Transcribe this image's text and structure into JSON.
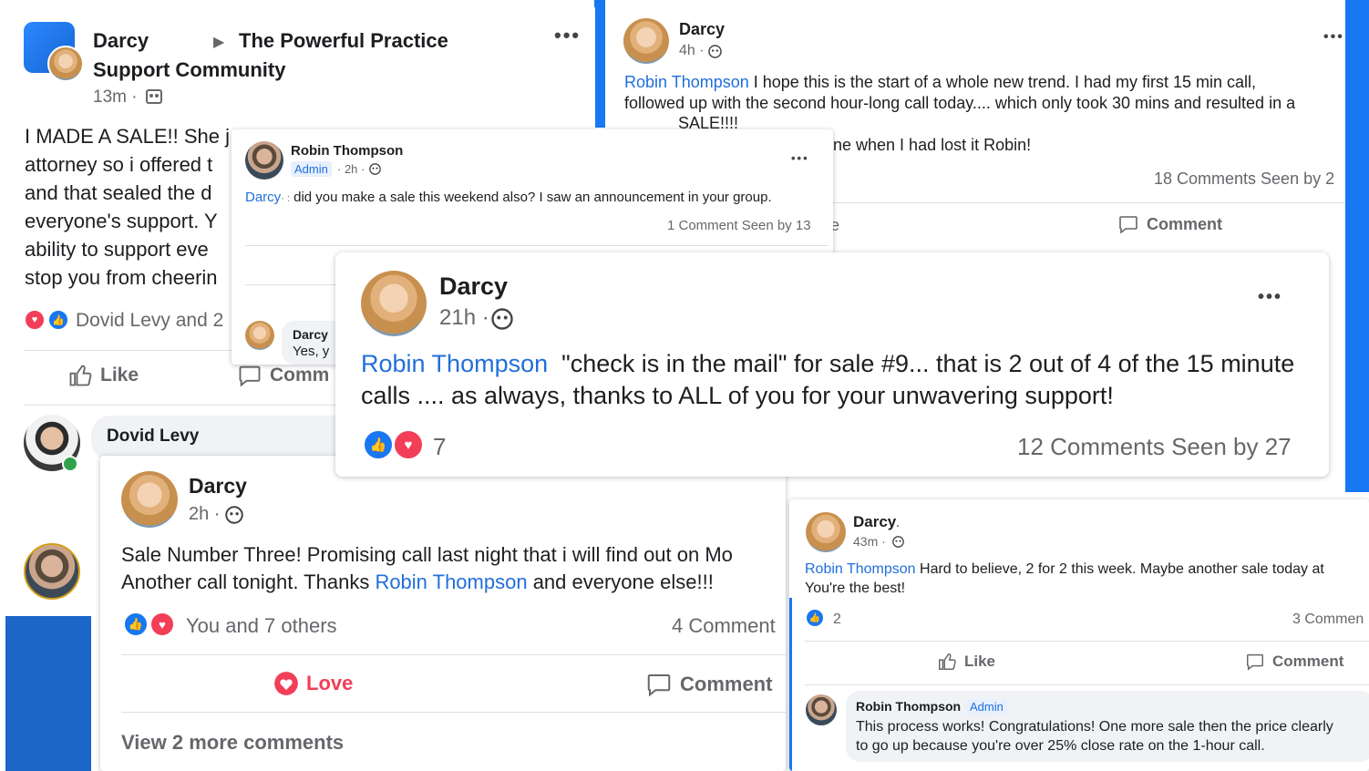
{
  "post_a": {
    "author": "Darcy",
    "arrow": "▶",
    "group_line1": "The Powerful Practice",
    "group_line2": "Support Community",
    "time": "13m ·",
    "body": [
      "I MADE A SALE!! She j",
      "attorney so i offered t",
      "and that sealed the d",
      "everyone's support. Y",
      "ability to support eve",
      "stop you from cheerin"
    ],
    "reactions_text": "Dovid Levy and 2",
    "like_label": "Like",
    "comment_label": "Comm"
  },
  "post_b": {
    "author": "Darcy",
    "time": "4h ·",
    "mention": "Robin Thompson",
    "line1": "I hope this is the start of a whole new trend. I had my first 15 min call,",
    "line2": "followed up with the second hour-long call today.... which only took 30 mins and resulted in a",
    "line3": "SALE!!!!",
    "line4": "ne when I had lost it Robin!",
    "stats": "18 Comments  Seen by 2",
    "comment_label": "Comment",
    "fragment": "e"
  },
  "post_c": {
    "author": "Robin Thompson",
    "admin": "Admin",
    "time": "· 2h ·",
    "mention": "Darcy",
    "mention_tail": "· :",
    "body": "did you make a sale this weekend also? I saw an announcement in your group.",
    "stats": "1 Comment  Seen by 13",
    "reply_author": "Darcy",
    "reply_text": "Yes, y"
  },
  "post_d": {
    "author": "Darcy",
    "time": "21h ·",
    "mention": "Robin Thompson",
    "line1": "\"check is in the mail\" for sale #9... that is 2 out of 4 of the 15 minute",
    "line2": "calls .... as always, thanks to ALL of you for your unwavering support!",
    "reaction_count": "7",
    "stats": "12 Comments  Seen by 27"
  },
  "post_e": {
    "dovid_name": "Dovid Levy",
    "author": "Darcy",
    "time": "2h ·",
    "line1": "Sale Number Three! Promising call last night that i will find out on Mo",
    "line2_pre": "Another call tonight. Thanks ",
    "mention": "Robin Thompson",
    "line2_post": " and everyone else!!!",
    "reactions_text": "You and 7 others",
    "comments": "4 Comment",
    "love_label": "Love",
    "comment_label": "Comment",
    "view_more": "View 2 more comments"
  },
  "post_f": {
    "author": "Darcy",
    "author_tail": ".",
    "time": "43m ·",
    "mention": "Robin Thompson",
    "line1": " Hard to believe, 2 for 2 this week. Maybe another sale today at",
    "line2": "You're the best!",
    "like_count": "2",
    "comments": "3 Commen",
    "like_label": "Like",
    "comment_label": "Comment",
    "reply_author": "Robin Thompson",
    "reply_admin": "Admin",
    "reply_line1": "This process works! Congratulations! One more sale then the price clearly",
    "reply_line2": "to go up because you're over 25% close rate on the 1-hour call."
  },
  "icons": [
    "more-icon",
    "globe-icon",
    "group-icon",
    "like-icon",
    "comment-icon",
    "love-icon"
  ],
  "colors": {
    "link": "#216fdb",
    "fb_blue": "#1877f2",
    "love": "#f33e58",
    "muted": "#65676b"
  }
}
